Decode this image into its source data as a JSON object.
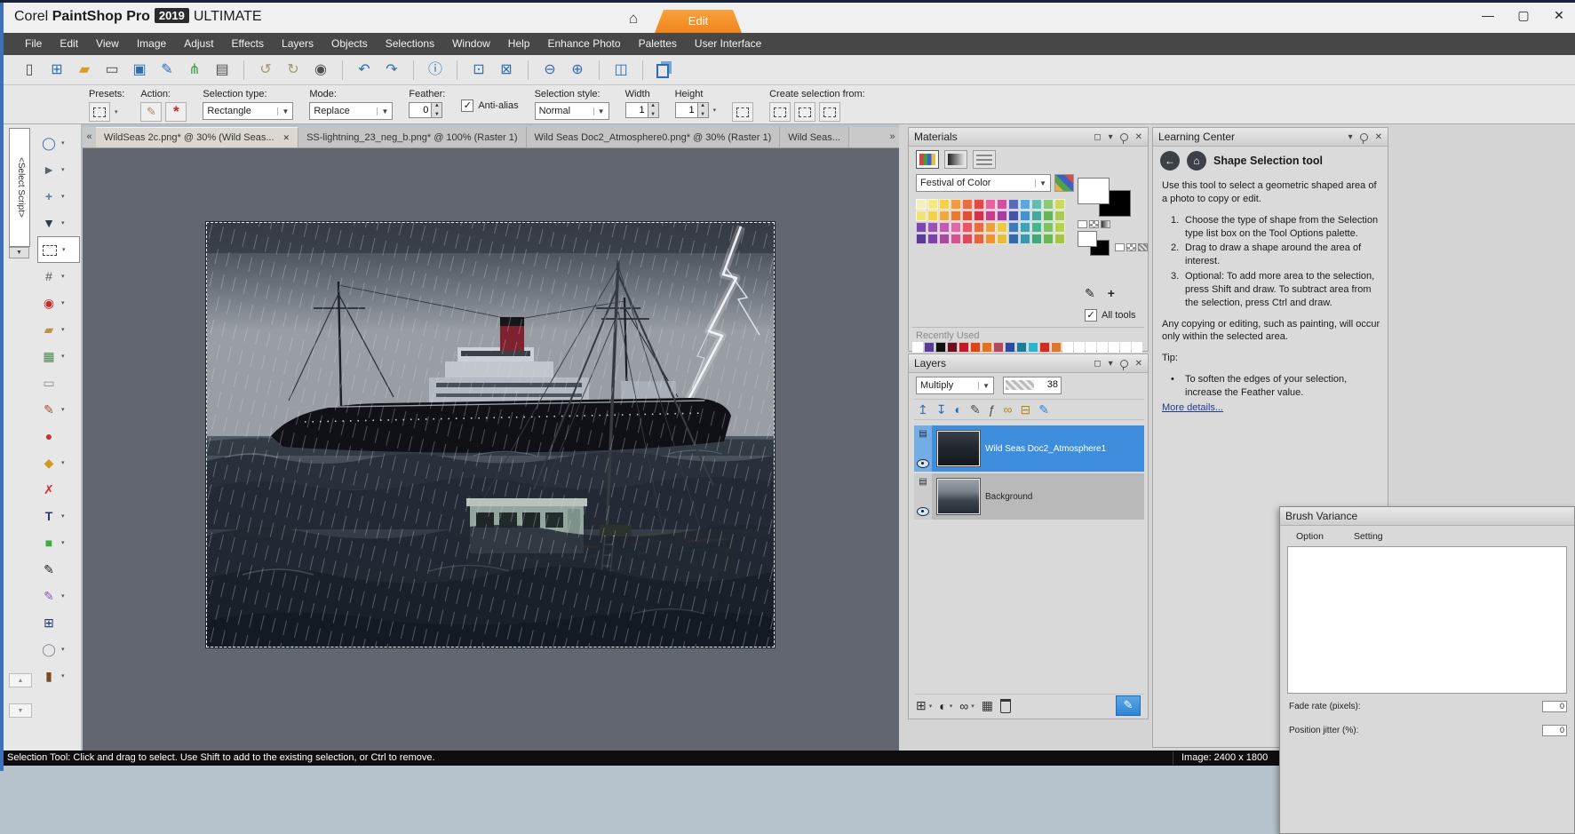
{
  "titlebar": {
    "brand": "Corel",
    "product": "PaintShop",
    "pro": "Pro",
    "year": "2019",
    "edition": "ULTIMATE",
    "edit_tab": "Edit",
    "home": "⌂",
    "min": "—",
    "max": "▢",
    "close": "✕"
  },
  "menubar": {
    "items": [
      "File",
      "Edit",
      "View",
      "Image",
      "Adjust",
      "Effects",
      "Layers",
      "Objects",
      "Selections",
      "Window",
      "Help",
      "Enhance Photo",
      "Palettes",
      "User Interface"
    ]
  },
  "toolbar": {
    "items": [
      {
        "name": "new-icon",
        "glyph": "▯",
        "color": "#4d4d4d"
      },
      {
        "name": "browse-icon",
        "glyph": "⊞",
        "color": "#2e6db4"
      },
      {
        "name": "open-icon",
        "glyph": "▰",
        "color": "#d89c28"
      },
      {
        "name": "express-lab-icon",
        "glyph": "▭",
        "color": "#4d4d4d"
      },
      {
        "name": "save-icon",
        "glyph": "▣",
        "color": "#2e6db4"
      },
      {
        "name": "save-as-icon",
        "glyph": "✎",
        "color": "#2e6db4"
      },
      {
        "name": "share-icon",
        "glyph": "⋔",
        "color": "#3a9a4a"
      },
      {
        "name": "print-icon",
        "glyph": "▤",
        "color": "#4d4d4d"
      },
      {
        "sep": true
      },
      {
        "name": "undo-history-icon",
        "glyph": "↺",
        "color": "#a39a70"
      },
      {
        "name": "redo-history-icon",
        "glyph": "↻",
        "color": "#a39a70"
      },
      {
        "name": "screen-capture-icon",
        "glyph": "◉",
        "color": "#4d4d4d"
      },
      {
        "sep": true
      },
      {
        "name": "undo-icon",
        "glyph": "↶",
        "color": "#2e6db4"
      },
      {
        "name": "redo-icon",
        "glyph": "↷",
        "color": "#2e6db4"
      },
      {
        "sep": true
      },
      {
        "name": "info-icon",
        "glyph": "ⓘ",
        "color": "#2e6db4"
      },
      {
        "sep": true
      },
      {
        "name": "palettes-icon",
        "glyph": "⊡",
        "color": "#2e6db4"
      },
      {
        "name": "random-palette-icon",
        "glyph": "⊠",
        "color": "#2e6db4"
      },
      {
        "sep": true
      },
      {
        "name": "zoom-out-icon",
        "glyph": "⊖",
        "color": "#2e6db4"
      },
      {
        "name": "zoom-in-icon",
        "glyph": "⊕",
        "color": "#2e6db4"
      },
      {
        "sep": true
      },
      {
        "name": "zoom-100-icon",
        "glyph": "◫",
        "color": "#2e6db4"
      },
      {
        "sep": true
      },
      {
        "name": "copy-special-icon",
        "glyph": "COPY",
        "color": "#2e6db4"
      }
    ]
  },
  "tool_options": {
    "presets_label": "Presets:",
    "action_label": "Action:",
    "selection_type_label": "Selection type:",
    "selection_type_value": "Rectangle",
    "mode_label": "Mode:",
    "mode_value": "Replace",
    "feather_label": "Feather:",
    "feather_value": "0",
    "antialias_label": "Anti-alias",
    "selection_style_label": "Selection style:",
    "selection_style_value": "Normal",
    "width_label": "Width",
    "width_value": "1",
    "height_label": "Height",
    "height_value": "1",
    "create_from_label": "Create selection from:"
  },
  "tool_palette": {
    "select_script": "<Select Script>",
    "tools": [
      {
        "name": "zoom-tool",
        "glyph": "◯",
        "color": "#2e6db4",
        "flyout": true
      },
      {
        "name": "pick-tool",
        "glyph": "►",
        "color": "#5a6470",
        "flyout": true
      },
      {
        "name": "move-tool",
        "glyph": "+",
        "color": "#5a7a9a",
        "flyout": true,
        "bold": true
      },
      {
        "name": "dropper-tool",
        "glyph": "▼",
        "color": "#2f3a44",
        "flyout": true
      },
      {
        "name": "selection-tool",
        "dashed": true,
        "flyout": true,
        "active": true
      },
      {
        "name": "crop-tool",
        "glyph": "#",
        "color": "#555555",
        "flyout": true
      },
      {
        "name": "red-eye-tool",
        "glyph": "◉",
        "color": "#cc2a2a",
        "flyout": true
      },
      {
        "name": "makeover-tool",
        "glyph": "▰",
        "color": "#bf8f50",
        "flyout": true
      },
      {
        "name": "clone-brush-tool",
        "glyph": "▦",
        "color": "#4a8a50",
        "flyout": true
      },
      {
        "name": "scratch-remover-tool",
        "glyph": "▭",
        "color": "#8a8a8a",
        "flyout": false
      },
      {
        "name": "paint-brush-tool",
        "glyph": "✎",
        "color": "#a0522d",
        "flyout": true
      },
      {
        "name": "eraser-tool",
        "glyph": "●",
        "color": "#c93030",
        "flyout": false
      },
      {
        "name": "flood-fill-tool",
        "glyph": "◆",
        "color": "#d09a20",
        "flyout": true
      },
      {
        "name": "color-replacer-tool",
        "glyph": "✗",
        "color": "#c93030",
        "flyout": false
      },
      {
        "name": "text-tool",
        "glyph": "T",
        "color": "#2a3a6a",
        "flyout": true,
        "bold": true
      },
      {
        "name": "preset-shape-tool",
        "glyph": "■",
        "color": "#3faa3f",
        "flyout": true
      },
      {
        "name": "pen-tool",
        "glyph": "✎",
        "color": "#222222",
        "flyout": false
      },
      {
        "name": "warp-brush-tool",
        "glyph": "✎",
        "color": "#8a5ab0",
        "flyout": true
      },
      {
        "name": "mesh-warp-tool",
        "glyph": "⊞",
        "color": "#1e3a6e",
        "flyout": false
      },
      {
        "name": "symmetric-shape-tool",
        "glyph": "◯",
        "color": "#808890",
        "flyout": true
      },
      {
        "name": "oil-brush-tool",
        "glyph": "▮",
        "color": "#7a4a20",
        "flyout": true
      }
    ]
  },
  "doc_tabs": {
    "prev": "«",
    "next": "»",
    "tabs": [
      {
        "label": "WildSeas 2c.png* @  30% (Wild Seas...",
        "active": true,
        "closable": true
      },
      {
        "label": "SS-lightning_23_neg_b.png* @ 100% (Raster 1)",
        "active": false,
        "closable": false
      },
      {
        "label": "Wild Seas Doc2_Atmosphere0.png* @  30% (Raster 1)",
        "active": false,
        "closable": false
      },
      {
        "label": "Wild Seas...",
        "active": false,
        "closable": false
      }
    ]
  },
  "materials": {
    "title": "Materials",
    "palette_name": "Festival of Color",
    "all_tools_label": "All tools",
    "recently_used_label": "Recently Used",
    "foreground_color": "#ffffff",
    "background_color": "#000000",
    "swatches": [
      "#f5f0c0",
      "#f7e97c",
      "#f7cf4a",
      "#f59a3c",
      "#f06a42",
      "#ef4444",
      "#ee5fa0",
      "#d44fa0",
      "#5a6ab8",
      "#5aa8dc",
      "#62bcb2",
      "#8cc878",
      "#ccd95e",
      "#efe279",
      "#f2d24a",
      "#f0a93c",
      "#e87a32",
      "#e05038",
      "#d8304a",
      "#c83c8c",
      "#a83ca0",
      "#4452aa",
      "#4492cc",
      "#44aa9c",
      "#64b45e",
      "#aacb52",
      "#7a4aaa",
      "#9a52b4",
      "#c05cb0",
      "#e268a4",
      "#ea5464",
      "#ec6a3c",
      "#eca03c",
      "#ecc843",
      "#3c7cbc",
      "#3ca4b4",
      "#4cb48c",
      "#7cc262",
      "#b4d24c",
      "#5a3c96",
      "#7c44a8",
      "#aa4a9c",
      "#d2548c",
      "#dc4a5c",
      "#e2663a",
      "#ec9434",
      "#eabc3c",
      "#3468ac",
      "#3898ac",
      "#42a87c",
      "#6ab852",
      "#a8c444"
    ],
    "recent_colors": [
      "#ffffff",
      "#5a3c96",
      "#111111",
      "#6b1020",
      "#c0182c",
      "#e04414",
      "#e4721c",
      "#b6485c",
      "#2c4c9c",
      "#1c7e96",
      "#2db4cc",
      "#d22c22",
      "#e0762c",
      "#ffffff",
      "#ffffff",
      "#ffffff",
      "#ffffff",
      "#ffffff",
      "#ffffff",
      "#ffffff"
    ]
  },
  "layers": {
    "title": "Layers",
    "blend_mode": "Multiply",
    "opacity_value": "38",
    "toolbar_icons": [
      {
        "name": "layer-up-icon",
        "glyph": "↥",
        "color": "#2e6db4"
      },
      {
        "name": "layer-down-icon",
        "glyph": "↧",
        "color": "#2e6db4"
      },
      {
        "name": "layer-new-art-icon",
        "glyph": "◐",
        "color": "#2e6db4"
      },
      {
        "name": "layer-edit-icon",
        "glyph": "✎",
        "color": "#4d4d4d"
      },
      {
        "name": "layer-script-icon",
        "glyph": "ƒ",
        "color": "#4d4d4d"
      },
      {
        "name": "layer-link-icon",
        "glyph": "∞",
        "color": "#b8860b"
      },
      {
        "name": "layer-lock-icon",
        "glyph": "⊟",
        "color": "#b8860b"
      },
      {
        "name": "layer-knife-icon",
        "glyph": "✎",
        "color": "#2e86d4"
      }
    ],
    "items": [
      {
        "name": "Wild Seas Doc2_Atmosphere1",
        "selected": true
      },
      {
        "name": "Background",
        "selected": false
      }
    ],
    "bottom_icons": [
      {
        "name": "new-layer-button",
        "glyph": "⊞",
        "color": "#333333",
        "flyout": true
      },
      {
        "name": "new-adjustment-layer-button",
        "glyph": "◐",
        "color": "#222222",
        "flyout": true
      },
      {
        "name": "new-mask-layer-button",
        "glyph": "∞",
        "color": "#222222",
        "flyout": true
      },
      {
        "name": "layer-group-button",
        "glyph": "▦",
        "color": "#333333",
        "flyout": false
      },
      {
        "name": "delete-layer-button",
        "glyph": "TRASH",
        "color": "#333333",
        "flyout": false
      },
      {
        "name": "edit-selection-button",
        "glyph": "✎",
        "color": "#ffffff",
        "blue": true,
        "flyout": false
      }
    ]
  },
  "learning_center": {
    "title": "Learning Center",
    "topic_title": "Shape Selection tool",
    "intro": "Use this tool to select a geometric shaped area of a photo to copy or edit.",
    "steps": [
      "Choose the type of shape from the Selection type list box on the Tool Options palette.",
      "Drag to draw a shape around the area of interest.",
      "Optional: To add more area to the selection, press Shift and draw. To subtract area from the selection, press Ctrl and draw."
    ],
    "note": "Any copying or editing, such as painting, will occur only within the selected area.",
    "tip_label": "Tip:",
    "tips": [
      "To soften the edges of your selection, increase the Feather value."
    ],
    "more_link": "More details..."
  },
  "brush_variance": {
    "title": "Brush Variance",
    "col_option": "Option",
    "col_setting": "Setting",
    "fade_rate_label": "Fade rate (pixels):",
    "fade_rate_value": "0",
    "position_jitter_label": "Position jitter (%):",
    "position_jitter_value": "0"
  },
  "statusbar": {
    "message": "Selection Tool: Click and drag to select. Use Shift to add to the existing selection, or Ctrl to remove.",
    "image_info": "Image:  2400 x 1800"
  }
}
